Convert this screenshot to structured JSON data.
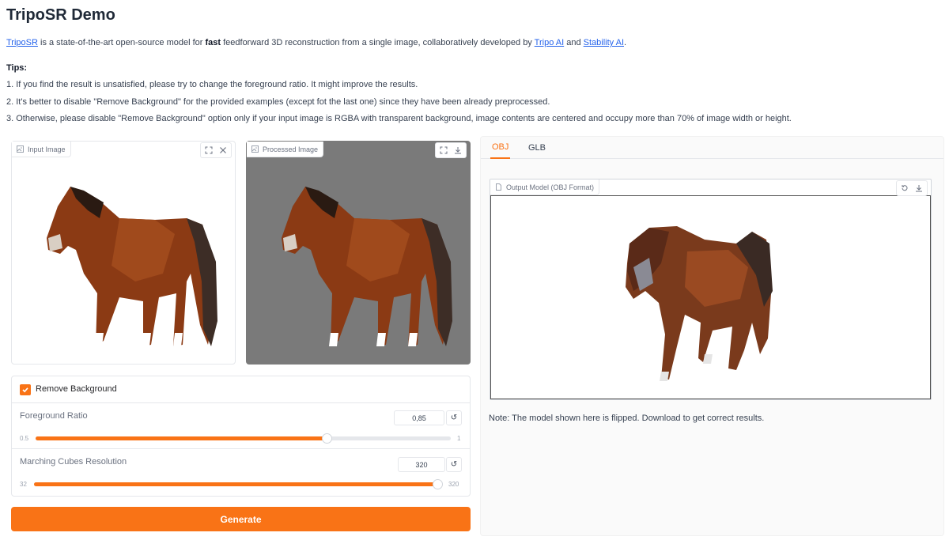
{
  "page": {
    "title": "TripoSR Demo",
    "intro": {
      "link_triposr": "TripoSR",
      "text_1": " is a state-of-the-art open-source model for ",
      "text_fast": "fast",
      "text_2": " feedforward 3D reconstruction from a single image, collaboratively developed by ",
      "link_tripo": "Tripo AI",
      "text_and": " and ",
      "link_stability": "Stability AI",
      "text_end": "."
    },
    "tips_heading": "Tips:",
    "tips": [
      "1. If you find the result is unsatisfied, please try to change the foreground ratio. It might improve the results.",
      "2. It's better to disable \"Remove Background\" for the provided examples (except fot the last one) since they have been already preprocessed.",
      "3. Otherwise, please disable \"Remove Background\" option only if your input image is RGBA with transparent background, image contents are centered and occupy more than 70% of image width or height."
    ]
  },
  "input_panel": {
    "label": "Input Image",
    "icons": [
      "image-icon",
      "fullscreen-icon",
      "close-icon"
    ]
  },
  "processed_panel": {
    "label": "Processed Image",
    "icons": [
      "image-icon",
      "fullscreen-icon",
      "download-icon"
    ],
    "background": "#7a7a7a"
  },
  "controls": {
    "remove_background": {
      "label": "Remove Background",
      "checked": true
    },
    "foreground_ratio": {
      "label": "Foreground Ratio",
      "value": "0,85",
      "min": "0.5",
      "max": "1",
      "fraction": 0.7
    },
    "marching_cubes": {
      "label": "Marching Cubes Resolution",
      "value": "320",
      "min": "32",
      "max": "320",
      "fraction": 1.0
    },
    "reset_glyph": "↺"
  },
  "generate_button": {
    "label": "Generate"
  },
  "output": {
    "tabs": [
      {
        "label": "OBJ",
        "active": true
      },
      {
        "label": "GLB",
        "active": false
      }
    ],
    "model_label": "Output Model (OBJ Format)",
    "note": "Note: The model shown here is flipped. Download to get correct results."
  },
  "colors": {
    "accent": "#f97316",
    "link": "#2563eb"
  }
}
